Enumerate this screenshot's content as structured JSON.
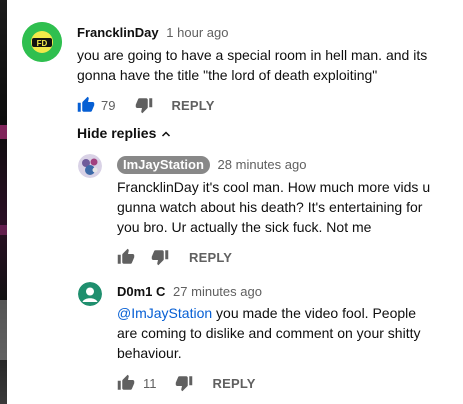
{
  "comment": {
    "author": "FrancklinDay",
    "time": "1 hour ago",
    "text_line1": "you are going to have a special room in hell man. and its",
    "text_line2": "gonna have the title \"the lord of death exploiting\"",
    "likes": "79",
    "reply_label": "REPLY",
    "avatar_initials": "FD",
    "avatar_color": "#26b84a"
  },
  "hide_replies_label": "Hide replies",
  "replies": [
    {
      "author": "ImJayStation",
      "time": "28 minutes ago",
      "text_line1": "FrancklinDay it's cool man. How much more vids u",
      "text_line2": "gunna watch about his death? It's entertaining for",
      "text_line3": "you bro. Ur actually the sick fuck. Not me",
      "reply_label": "REPLY"
    },
    {
      "author": "D0m1 C",
      "time": "27 minutes ago",
      "mention": "@ImJayStation",
      "text_line1_rest": " you made the video fool. People",
      "text_line2": "are coming to dislike and comment on your shitty",
      "text_line3": "behaviour.",
      "likes": "11",
      "reply_label": "REPLY",
      "avatar_color": "#1f8f6e"
    }
  ],
  "colors": {
    "liked_blue": "#065fd4",
    "icon_gray": "#606060",
    "chip_gray": "#888888"
  }
}
